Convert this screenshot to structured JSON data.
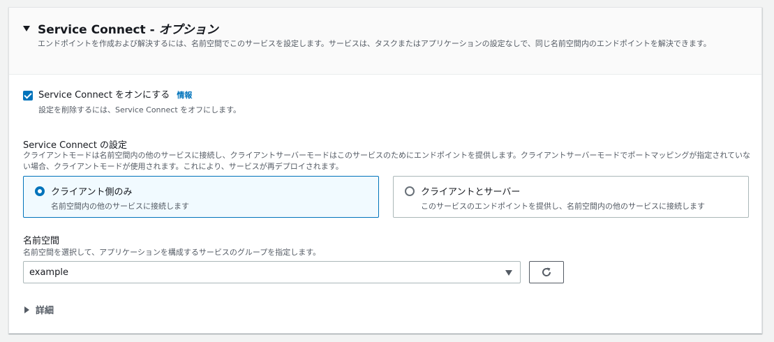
{
  "section": {
    "title_main": "Service Connect - ",
    "title_option": "オプション",
    "description": "エンドポイントを作成および解決するには、名前空間でこのサービスを設定します。サービスは、タスクまたはアプリケーションの設定なしで、同じ名前空間内のエンドポイントを解決できます。"
  },
  "toggle": {
    "label": "Service Connect をオンにする",
    "info_link": "情報",
    "description": "設定を削除するには、Service Connect をオフにします。",
    "checked": true
  },
  "config": {
    "title": "Service Connect の設定",
    "description": "クライアントモードは名前空間内の他のサービスに接続し、クライアントサーバーモードはこのサービスのためにエンドポイントを提供します。クライアントサーバーモードでポートマッピングが指定されていない場合、クライアントモードが使用されます。これにより、サービスが再デプロイされます。",
    "options": [
      {
        "label": "クライアント側のみ",
        "description": "名前空間内の他のサービスに接続します",
        "selected": true
      },
      {
        "label": "クライアントとサーバー",
        "description": "このサービスのエンドポイントを提供し、名前空間内の他のサービスに接続します",
        "selected": false
      }
    ]
  },
  "namespace": {
    "title": "名前空間",
    "description": "名前空間を選択して、アプリケーションを構成するサービスのグループを指定します。",
    "selected_value": "example",
    "refresh_icon": "refresh-icon"
  },
  "details": {
    "label": "詳細"
  },
  "colors": {
    "accent": "#0073bb",
    "selected_tile_bg": "#f1faff"
  }
}
